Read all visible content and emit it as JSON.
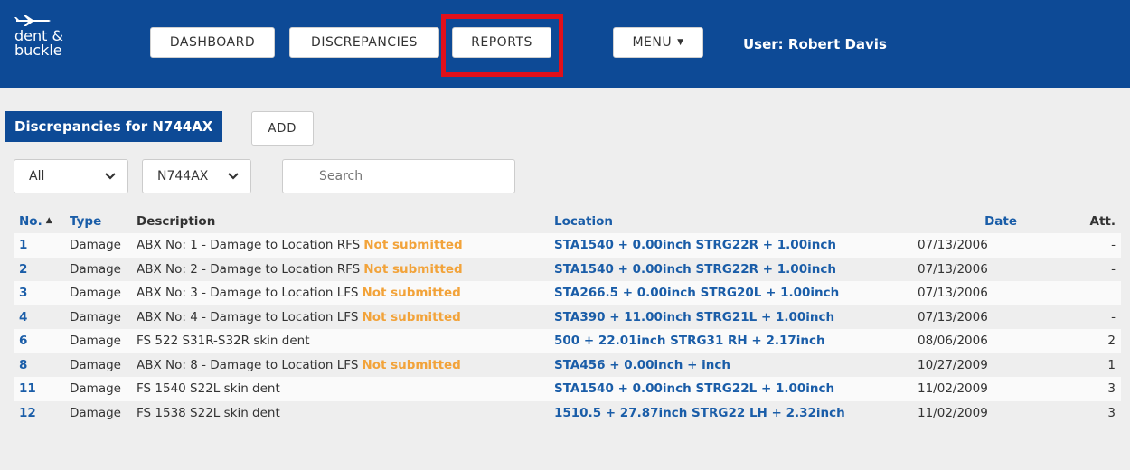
{
  "app": {
    "logo_text": "dent &\nbuckle",
    "user_label": "User: Robert Davis"
  },
  "nav": {
    "dashboard": "DASHBOARD",
    "discrepancies": "DISCREPANCIES",
    "reports": "REPORTS",
    "menu": "MENU"
  },
  "page": {
    "title": "Discrepancies for N744AX",
    "add_label": "ADD"
  },
  "filters": {
    "type_value": "All",
    "aircraft_value": "N744AX",
    "search_placeholder": "Search"
  },
  "colors": {
    "header_bg": "#0d4a96",
    "link": "#1a5da8",
    "status_warning": "#f2a33a",
    "highlight_border": "#e0101a"
  },
  "table": {
    "columns": {
      "no": "No.",
      "type": "Type",
      "description": "Description",
      "location": "Location",
      "date": "Date",
      "att": "Att."
    },
    "sort_column": "No.",
    "sort_direction": "ascending",
    "rows": [
      {
        "no": "1",
        "type": "Damage",
        "description": "ABX No: 1 - Damage to Location RFS",
        "status": "Not submitted",
        "location": "STA1540 + 0.00inch STRG22R + 1.00inch",
        "date": "07/13/2006",
        "att": "-"
      },
      {
        "no": "2",
        "type": "Damage",
        "description": "ABX No: 2 - Damage to Location RFS",
        "status": "Not submitted",
        "location": "STA1540 + 0.00inch STRG22R + 1.00inch",
        "date": "07/13/2006",
        "att": "-"
      },
      {
        "no": "3",
        "type": "Damage",
        "description": "ABX No: 3 - Damage to Location LFS",
        "status": "Not submitted",
        "location": "STA266.5 + 0.00inch STRG20L + 1.00inch",
        "date": "07/13/2006",
        "att": ""
      },
      {
        "no": "4",
        "type": "Damage",
        "description": "ABX No: 4 - Damage to Location LFS",
        "status": "Not submitted",
        "location": "STA390 + 11.00inch STRG21L + 1.00inch",
        "date": "07/13/2006",
        "att": "-"
      },
      {
        "no": "6",
        "type": "Damage",
        "description": "FS 522 S31R-S32R skin dent",
        "status": "",
        "location": "500 + 22.01inch STRG31 RH + 2.17inch",
        "date": "08/06/2006",
        "att": "2"
      },
      {
        "no": "8",
        "type": "Damage",
        "description": "ABX No: 8 - Damage to Location LFS",
        "status": "Not submitted",
        "location": "STA456 + 0.00inch + inch",
        "date": "10/27/2009",
        "att": "1"
      },
      {
        "no": "11",
        "type": "Damage",
        "description": "FS 1540 S22L skin dent",
        "status": "",
        "location": "STA1540 + 0.00inch STRG22L + 1.00inch",
        "date": "11/02/2009",
        "att": "3"
      },
      {
        "no": "12",
        "type": "Damage",
        "description": "FS 1538 S22L skin dent",
        "status": "",
        "location": "1510.5 + 27.87inch STRG22 LH + 2.32inch",
        "date": "11/02/2009",
        "att": "3"
      }
    ]
  }
}
